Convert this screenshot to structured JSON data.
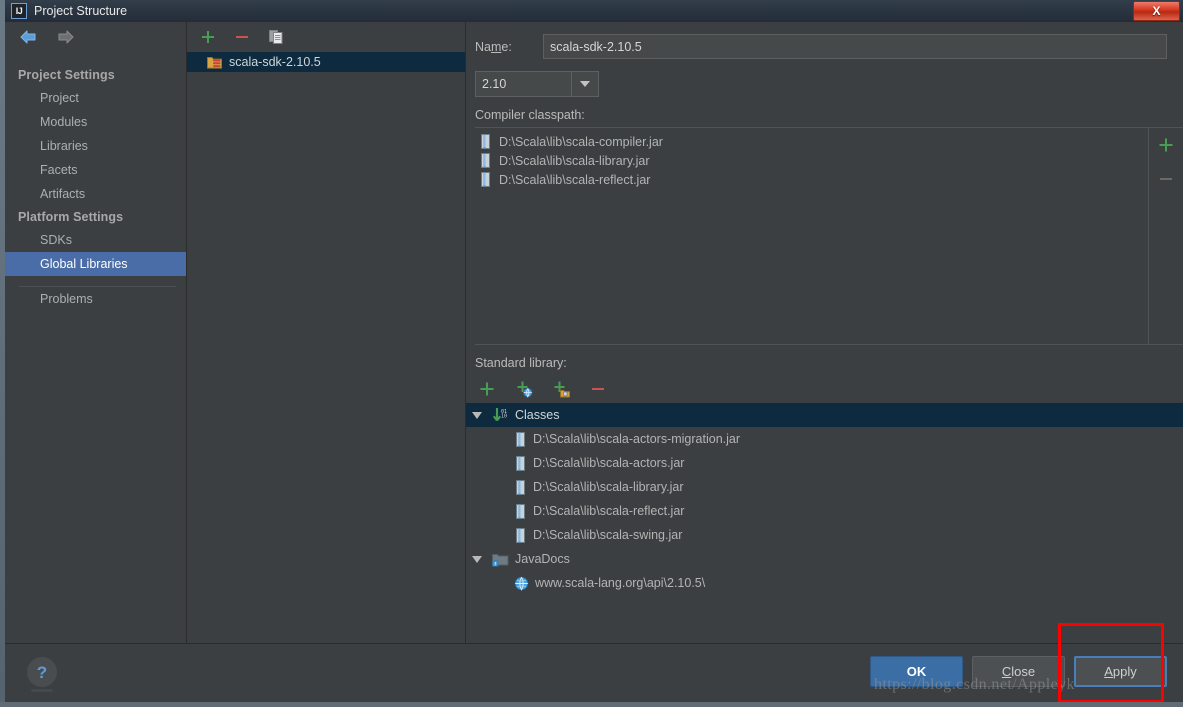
{
  "window": {
    "title": "Project Structure",
    "logo_icon": "intellij-idea-logo-icon",
    "close_icon": "close-x-icon",
    "close_label": "X"
  },
  "nav": {
    "back_icon": "arrow-left-icon",
    "forward_icon": "arrow-right-icon"
  },
  "sidebar": {
    "groups": [
      {
        "label": "Project Settings",
        "items": [
          {
            "label": "Project",
            "selected": false
          },
          {
            "label": "Modules",
            "selected": false
          },
          {
            "label": "Libraries",
            "selected": false
          },
          {
            "label": "Facets",
            "selected": false
          },
          {
            "label": "Artifacts",
            "selected": false
          }
        ]
      },
      {
        "label": "Platform Settings",
        "items": [
          {
            "label": "SDKs",
            "selected": false
          },
          {
            "label": "Global Libraries",
            "selected": true
          }
        ]
      }
    ],
    "problems": {
      "label": "Problems"
    }
  },
  "library_list": {
    "toolbar": [
      {
        "name": "add-library-button",
        "icon": "plus-icon"
      },
      {
        "name": "remove-library-button",
        "icon": "minus-icon"
      },
      {
        "name": "copy-library-button",
        "icon": "copy-icon"
      }
    ],
    "items": [
      {
        "label": "scala-sdk-2.10.5",
        "icon": "scala-library-folder-icon",
        "selected": true
      }
    ]
  },
  "detail": {
    "name_label": "Name:",
    "name_label_pre": "Na",
    "name_label_mnemonic": "m",
    "name_label_post": "e:",
    "name_value": "scala-sdk-2.10.5",
    "version_combo": {
      "value": "2.10",
      "arrow_icon": "chevron-down-icon"
    },
    "compiler_classpath": {
      "label": "Compiler classpath:",
      "entries": [
        {
          "path": "D:\\Scala\\lib\\scala-compiler.jar",
          "icon": "jar-file-icon"
        },
        {
          "path": "D:\\Scala\\lib\\scala-library.jar",
          "icon": "jar-file-icon"
        },
        {
          "path": "D:\\Scala\\lib\\scala-reflect.jar",
          "icon": "jar-file-icon"
        }
      ],
      "add_icon": "plus-icon",
      "remove_icon": "minus-icon-disabled"
    },
    "standard_library": {
      "label": "Standard library:",
      "toolbar": [
        {
          "name": "add-entry-button",
          "icon": "plus-icon"
        },
        {
          "name": "add-url-button",
          "icon": "plus-globe-icon"
        },
        {
          "name": "add-jar-directory-button",
          "icon": "plus-archive-icon"
        },
        {
          "name": "remove-entry-button",
          "icon": "minus-icon"
        }
      ],
      "tree": [
        {
          "label": "Classes",
          "icon": "classes-root-icon",
          "expanded": true,
          "selected": true,
          "expander_icon": "triangle-down-icon",
          "children": [
            {
              "label": "D:\\Scala\\lib\\scala-actors-migration.jar",
              "icon": "jar-file-icon"
            },
            {
              "label": "D:\\Scala\\lib\\scala-actors.jar",
              "icon": "jar-file-icon"
            },
            {
              "label": "D:\\Scala\\lib\\scala-library.jar",
              "icon": "jar-file-icon"
            },
            {
              "label": "D:\\Scala\\lib\\scala-reflect.jar",
              "icon": "jar-file-icon"
            },
            {
              "label": "D:\\Scala\\lib\\scala-swing.jar",
              "icon": "jar-file-icon"
            }
          ]
        },
        {
          "label": "JavaDocs",
          "icon": "javadoc-folder-icon",
          "expanded": true,
          "selected": false,
          "expander_icon": "triangle-down-icon",
          "children": [
            {
              "label": "www.scala-lang.org\\api\\2.10.5\\",
              "icon": "globe-icon"
            }
          ]
        }
      ]
    }
  },
  "footer": {
    "help_icon": "help-question-icon",
    "help_label": "?",
    "buttons": [
      {
        "name": "ok-button",
        "label": "OK",
        "style": "default"
      },
      {
        "name": "close-button",
        "label": "Close",
        "mnemonic_pre": "",
        "mnemonic": "C",
        "mnemonic_post": "lose",
        "style": "normal"
      },
      {
        "name": "apply-button",
        "label": "Apply",
        "mnemonic_pre": "",
        "mnemonic": "A",
        "mnemonic_post": "pply",
        "style": "focused"
      }
    ]
  },
  "annotation": {
    "type": "red-rectangle-highlight",
    "target": "apply-button"
  },
  "watermark": {
    "text": "https://blog.csdn.net/Appleyk"
  },
  "colors": {
    "window_bg": "#3c3f41",
    "titlebar": "#2a3441",
    "sidebar_selection": "#4a6da7",
    "tree_selection": "#0d2a3f",
    "accent_green": "#499c54",
    "accent_red": "#c75450",
    "default_button": "#3b6ea5",
    "annotation_red": "#ff0000"
  }
}
